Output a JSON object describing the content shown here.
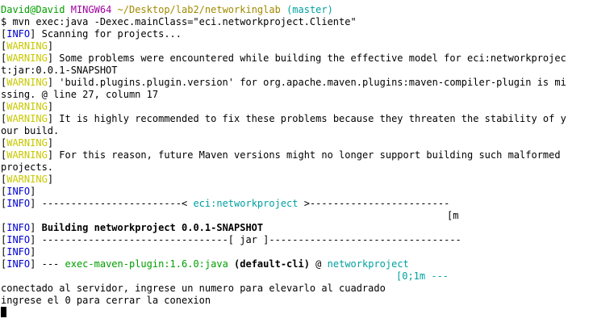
{
  "prompt": {
    "user_host": "David@David",
    "system": "MINGW64",
    "path": "~/Desktop/lab2/networkinglab",
    "branch": "(master)"
  },
  "command": "$ mvn exec:java -Dexec.mainClass=\"eci.networkproject.Cliente\"",
  "tags": {
    "info": "INFO",
    "warning": "WARNING"
  },
  "lines": {
    "scanning": " Scanning for projects...",
    "problems_1": " Some problems were encountered while building the effective model for eci:networkprojec",
    "problems_2": "t:jar:0.0.1-SNAPSHOT",
    "plugin_version_1": " 'build.plugins.plugin.version' for org.apache.maven.plugins:maven-compiler-plugin is mi",
    "plugin_version_2": "ssing. @ line 27, column 17",
    "recommend_1": " It is highly recommended to fix these problems because they threaten the stability of y",
    "recommend_2": "our build.",
    "future_1": " For this reason, future Maven versions might no longer support building such malformed",
    "future_2": "projects.",
    "project_sep_left": " ------------------------< ",
    "project_name": "eci:networkproject",
    "project_sep_right": " >------------------------",
    "escape_m": "[m",
    "building": " Building networkproject 0.0.1-SNAPSHOT",
    "jar_sep": " --------------------------------[ jar ]---------------------------------",
    "plugin_dash": " --- ",
    "plugin_name": "exec-maven-plugin:1.6.0:java",
    "plugin_cli": " (default-cli)",
    "plugin_at": " @ ",
    "plugin_project": "networkproject",
    "escape_tail": "[0;1m ---",
    "connected": "conectado al servidor, ingrese un numero para elevarlo al cuadrado",
    "close_hint": "ingrese el 0 para cerrar la conexion"
  },
  "colors": {
    "user": "#00a000",
    "host": "#a000a0",
    "path": "#a08a00",
    "branch": "#00a0a0",
    "info": "#0000d0",
    "warning": "#c8c800"
  }
}
